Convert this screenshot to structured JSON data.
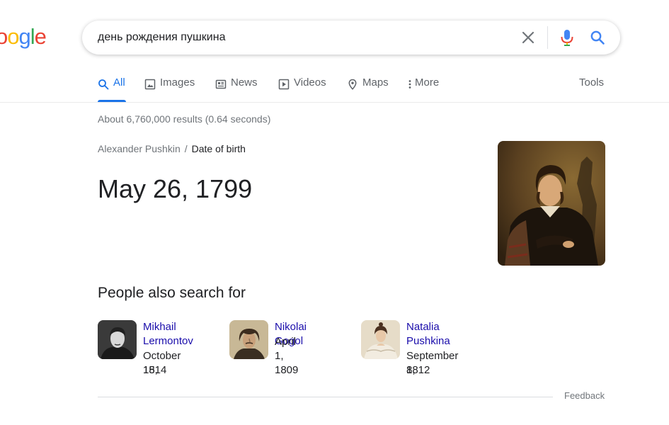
{
  "logo": {
    "text": "oogle",
    "letters": [
      {
        "ch": "o",
        "color": "#EA4335"
      },
      {
        "ch": "o",
        "color": "#FBBC05"
      },
      {
        "ch": "g",
        "color": "#4285F4"
      },
      {
        "ch": "l",
        "color": "#34A853"
      },
      {
        "ch": "e",
        "color": "#EA4335"
      }
    ]
  },
  "search": {
    "value": "день рождения пушкина"
  },
  "icons": {
    "clear": "close-icon",
    "mic": "mic-icon",
    "search": "search-icon"
  },
  "tabs": [
    {
      "label": "All",
      "icon": "search-icon",
      "active": true
    },
    {
      "label": "Images",
      "icon": "image-icon",
      "active": false
    },
    {
      "label": "News",
      "icon": "news-icon",
      "active": false
    },
    {
      "label": "Videos",
      "icon": "play-icon",
      "active": false
    },
    {
      "label": "Maps",
      "icon": "map-pin-icon",
      "active": false
    },
    {
      "label": "More",
      "icon": "more-vert-icon",
      "active": false
    }
  ],
  "tools_label": "Tools",
  "results_stats": "About 6,760,000 results (0.64 seconds)",
  "breadcrumb": {
    "entity": "Alexander Pushkin",
    "separator": "/",
    "attribute": "Date of birth"
  },
  "answer": "May 26, 1799",
  "people_also_search": {
    "title": "People also search for",
    "people": [
      {
        "name_line1": "Mikhail",
        "name_line2": "Lermontov",
        "date_line1": "October 15,",
        "date_line2": "1814"
      },
      {
        "name_line1": "Nikolai Gogol",
        "name_line2": "",
        "date_line1": "April 1, 1809",
        "date_line2": ""
      },
      {
        "name_line1": "Natalia",
        "name_line2": "Pushkina",
        "date_line1": "September 8,",
        "date_line2": "1812"
      }
    ]
  },
  "feedback_label": "Feedback",
  "colors": {
    "accent": "#1a73e8",
    "link": "#1a0dab",
    "muted": "#70757a"
  }
}
